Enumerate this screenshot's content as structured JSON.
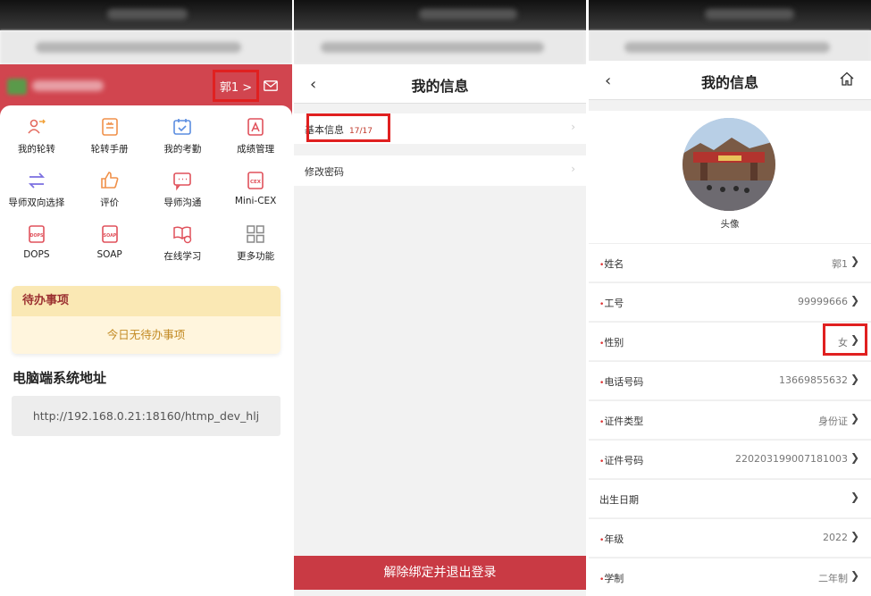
{
  "panel1": {
    "user_chip": "郭1 >",
    "grid": [
      {
        "label": "我的轮转",
        "icon": "rotation-icon"
      },
      {
        "label": "轮转手册",
        "icon": "handbook-icon"
      },
      {
        "label": "我的考勤",
        "icon": "attendance-calendar-icon"
      },
      {
        "label": "成绩管理",
        "icon": "grade-document-icon"
      },
      {
        "label": "导师双向选择",
        "icon": "swap-arrows-icon"
      },
      {
        "label": "评价",
        "icon": "thumbs-up-icon"
      },
      {
        "label": "导师沟通",
        "icon": "chat-icon"
      },
      {
        "label": "Mini-CEX",
        "icon": "cex-form-icon"
      },
      {
        "label": "DOPS",
        "icon": "dops-form-icon"
      },
      {
        "label": "SOAP",
        "icon": "soap-form-icon"
      },
      {
        "label": "在线学习",
        "icon": "online-learning-icon"
      },
      {
        "label": "更多功能",
        "icon": "grid-more-icon"
      }
    ],
    "todo_title": "待办事项",
    "todo_empty": "今日无待办事项",
    "pc_title": "电脑端系统地址",
    "pc_url": "http://192.168.0.21:18160/htmp_dev_hlj"
  },
  "panel2": {
    "title": "我的信息",
    "rows": [
      {
        "label": "基本信息",
        "count": "17/17"
      },
      {
        "label": "修改密码"
      }
    ],
    "logout": "解除绑定并退出登录"
  },
  "panel3": {
    "title": "我的信息",
    "avatar_label": "头像",
    "fields": [
      {
        "label": "姓名",
        "value": "郭1",
        "required": true
      },
      {
        "label": "工号",
        "value": "99999666",
        "required": true
      },
      {
        "label": "性别",
        "value": "女",
        "required": true
      },
      {
        "label": "电话号码",
        "value": "13669855632",
        "required": true
      },
      {
        "label": "证件类型",
        "value": "身份证",
        "required": true
      },
      {
        "label": "证件号码",
        "value": "220203199007181003",
        "required": true
      },
      {
        "label": "出生日期",
        "value": "",
        "required": false
      },
      {
        "label": "年级",
        "value": "2022",
        "required": true
      },
      {
        "label": "学制",
        "value": "二年制",
        "required": true
      }
    ],
    "required_mark": "•",
    "arrow": "❯"
  },
  "colors": {
    "brand_red": "#d1454f",
    "highlight_red": "#e02020",
    "todo_header": "#fae8b4",
    "todo_body": "#fff5dd"
  }
}
